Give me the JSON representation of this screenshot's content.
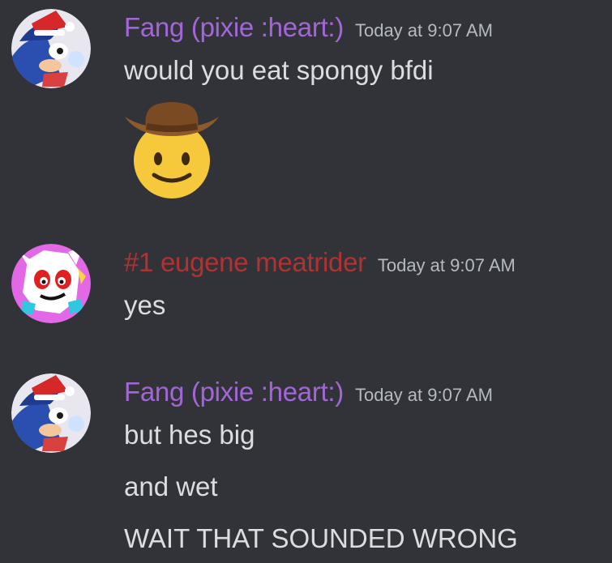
{
  "colors": {
    "background": "#313338",
    "message_text": "#dbdee1",
    "timestamp": "#b5bac1",
    "fang_name": "#a366d6",
    "eugene_name": "#b03232"
  },
  "messages": [
    {
      "author": "Fang (pixie :heart:)",
      "timestamp": "Today at 9:07 AM",
      "avatar_icon": "sonic-santa-hat-avatar",
      "lines": [
        "would you eat spongy bfdi"
      ],
      "emoji": "cowboy-hat-face-emoji"
    },
    {
      "author": "#1 eugene meatrider",
      "timestamp": "Today at 9:07 AM",
      "avatar_icon": "cartoon-character-avatar",
      "lines": [
        "yes"
      ]
    },
    {
      "author": "Fang (pixie :heart:)",
      "timestamp": "Today at 9:07 AM",
      "avatar_icon": "sonic-santa-hat-avatar",
      "lines": [
        "but hes big",
        "and wet",
        "WAIT THAT SOUNDED WRONG"
      ]
    }
  ]
}
